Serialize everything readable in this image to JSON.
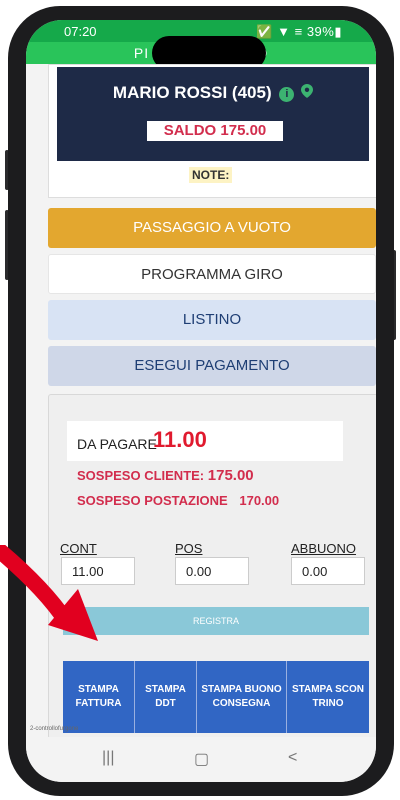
{
  "status_bar": {
    "time": "07:20",
    "icons": "✅ ▼ ≡ 39%▮"
  },
  "appbar": {
    "title": "PI                    TO"
  },
  "customer": {
    "name": "MARIO ROSSI (405)",
    "info_icon": "info-icon",
    "location_icon": "location-pin-icon",
    "saldo": "SALDO 175.00",
    "note_label": "NOTE:"
  },
  "buttons": {
    "passaggio": "PASSAGGIO A VUOTO",
    "programma": "PROGRAMMA GIRO",
    "listino": "LISTINO",
    "pagamento": "ESEGUI PAGAMENTO"
  },
  "payment": {
    "due_label": "DA PAGARE",
    "due_value": "11.00",
    "sospeso_cliente_label": "SOSPESO CLIENTE:",
    "sospeso_cliente_value": "175.00",
    "sospeso_postazione_label": "SOSPESO POSTAZIONE",
    "sospeso_postazione_value": "170.00",
    "cont_label": "CONT",
    "cont_value": "11.00",
    "pos_label": "POS",
    "pos_value": "0.00",
    "abbuono_label": "ABBUONO",
    "abbuono_value": "0.00",
    "registra": "REGISTRA"
  },
  "stampa": [
    "STAMPA FATTURA",
    "STAMPA DDT",
    "STAMPA BUONO CONSEGNA",
    "STAMPA SCON TRINO"
  ],
  "footer": {
    "text": "2-controllofurgone"
  },
  "colors": {
    "accent_green": "#29c45a",
    "header_navy": "#1e2a47",
    "orange": "#e3a72f",
    "stampa_blue": "#3166c4",
    "alert_red": "#e01a2e"
  }
}
